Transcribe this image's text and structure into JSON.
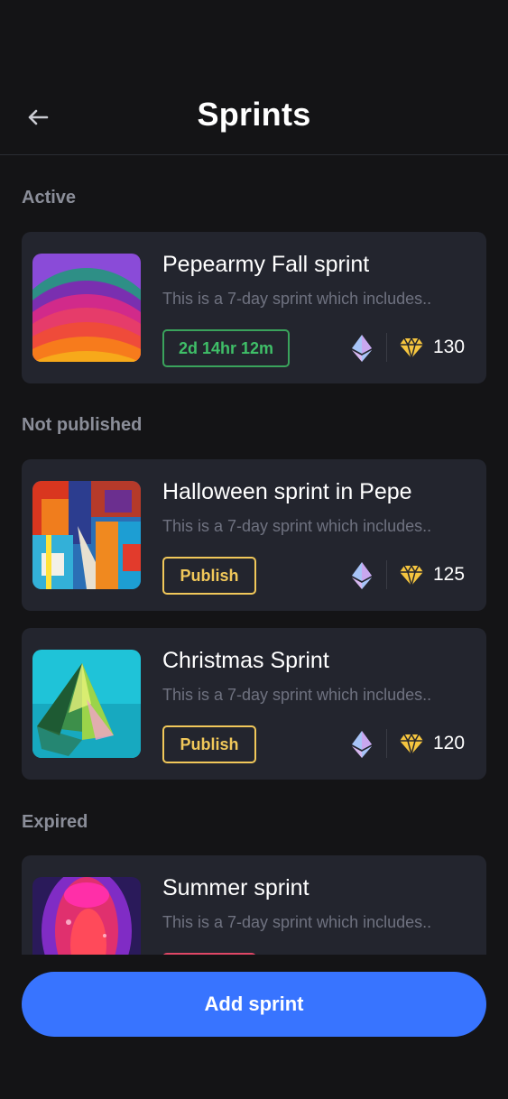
{
  "header": {
    "title": "Sprints",
    "back_icon": "arrow-left-icon"
  },
  "sections": {
    "active": {
      "label": "Active"
    },
    "not_published": {
      "label": "Not published"
    },
    "expired": {
      "label": "Expired"
    }
  },
  "sprints": [
    {
      "title": "Pepearmy Fall sprint",
      "description": "This is a 7-day sprint which includes..",
      "badge": "2d 14hr 12m",
      "badge_type": "timer",
      "reward": "130"
    },
    {
      "title": "Halloween sprint in Pepe",
      "description": "This is a 7-day sprint which includes..",
      "badge": "Publish",
      "badge_type": "publish",
      "reward": "125"
    },
    {
      "title": "Christmas Sprint",
      "description": "This is a 7-day sprint which includes..",
      "badge": "Publish",
      "badge_type": "publish",
      "reward": "120"
    },
    {
      "title": "Summer sprint",
      "description": "This is a 7-day sprint which includes..",
      "badge": "",
      "badge_type": "expired",
      "reward": ""
    }
  ],
  "icons": {
    "currency": "ethereum-icon",
    "points": "diamond-icon"
  },
  "colors": {
    "background": "#141416",
    "card": "#23252e",
    "accent": "#3874ff",
    "timer": "#3fbf68",
    "publish": "#f1c85a",
    "expired": "#e04766"
  },
  "footer": {
    "add_label": "Add sprint"
  }
}
